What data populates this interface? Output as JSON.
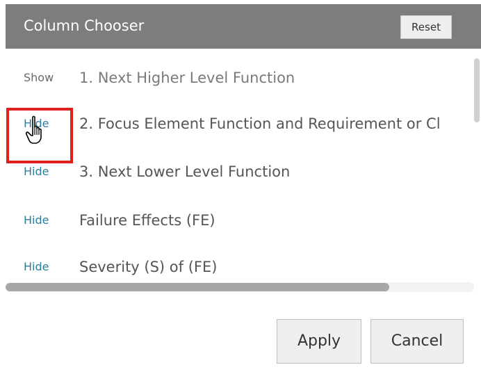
{
  "dialog": {
    "title": "Column Chooser",
    "reset_label": "Reset",
    "apply_label": "Apply",
    "cancel_label": "Cancel"
  },
  "columns": [
    {
      "toggle": "Show",
      "label": "1. Next Higher Level Function",
      "visible": false
    },
    {
      "toggle": "Hide",
      "label": "2. Focus Element Function and Requirement or Cl",
      "visible": true
    },
    {
      "toggle": "Hide",
      "label": "3. Next Lower Level Function",
      "visible": true
    },
    {
      "toggle": "Hide",
      "label": "Failure Effects (FE)",
      "visible": true
    },
    {
      "toggle": "Hide",
      "label": "Severity (S) of (FE)",
      "visible": true
    }
  ],
  "colors": {
    "titlebar": "#7d7d7d",
    "hide_link": "#2e7c96",
    "show_link": "#6a6a6a",
    "highlight": "#e0201c"
  },
  "icons": {
    "cursor": "hand-pointer-icon"
  }
}
